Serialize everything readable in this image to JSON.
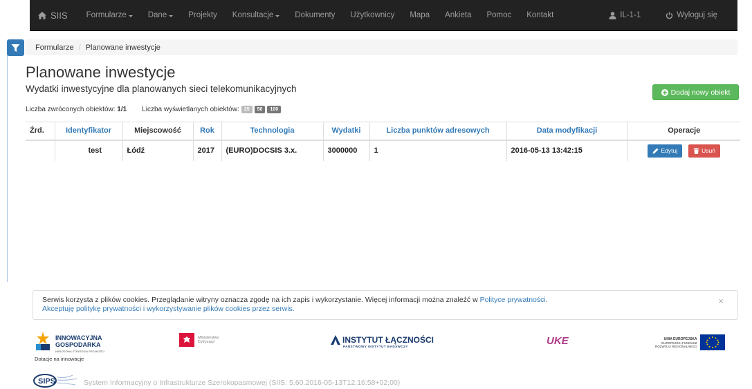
{
  "navbar": {
    "brand": "SIIS",
    "items": [
      {
        "label": "Formularze",
        "dropdown": true
      },
      {
        "label": "Dane",
        "dropdown": true
      },
      {
        "label": "Projekty",
        "dropdown": false
      },
      {
        "label": "Konsultacje",
        "dropdown": true
      },
      {
        "label": "Dokumenty",
        "dropdown": false
      },
      {
        "label": "Użytkownicy",
        "dropdown": false
      },
      {
        "label": "Mapa",
        "dropdown": false
      },
      {
        "label": "Ankieta",
        "dropdown": false
      },
      {
        "label": "Pomoc",
        "dropdown": false
      },
      {
        "label": "Kontakt",
        "dropdown": false
      }
    ],
    "user": "IL-1-1",
    "logout": "Wyloguj się"
  },
  "breadcrumb": {
    "parent": "Formularze",
    "current": "Planowane inwestycje"
  },
  "page": {
    "title": "Planowane inwestycje",
    "subtitle": "Wydatki inwestycyjne dla planowanych sieci telekomunikacyjnych",
    "add_button": "Dodaj nowy obiekt",
    "returned_label": "Liczba zwróconych obiektów:",
    "returned_value": "1/1",
    "displayed_label": "Liczba wyświetlanych obiektów:",
    "page_sizes": [
      "25",
      "50",
      "100"
    ]
  },
  "table": {
    "headers": [
      "Źrd.",
      "Identyfikator",
      "Miejscowość",
      "Rok",
      "Technologia",
      "Wydatki",
      "Liczba punktów adresowych",
      "Data modyfikacji",
      "Operacje"
    ],
    "rows": [
      {
        "zrd": "",
        "identyfikator": "test",
        "miejscowosc": "Łódź",
        "rok": "2017",
        "technologia": "(EURO)DOCSIS 3.x.",
        "wydatki": "3000000",
        "liczba_punktow": "1",
        "data": "2016-05-13 13:42:15"
      }
    ],
    "edit_label": "Edytuj",
    "delete_label": "Usuń"
  },
  "cookie": {
    "text": "Serwis korzysta z plików cookies. Przeglądanie witryny oznacza zgodę na ich zapis i wykorzystanie. Więcej informacji można znaleźć w",
    "policy_link": "Polityce prywatności.",
    "accept_link": "Akceptuję politykę prywatności i wykorzystywanie plików cookies przez serwis.",
    "close": "×"
  },
  "footer": {
    "ig_line1": "INNOWACYJNA",
    "ig_line2": "GOSPODARKA",
    "ig_line3": "NARODOWA STRATEGIA SPÓJNOŚCI",
    "ig_caption": "Dotacje na innowacje",
    "ministry_line1": "Ministerstwo",
    "ministry_line2": "Cyfryzacji",
    "il_main": "INSTYTUT ŁĄCZNOŚCI",
    "il_sub": "PAŃSTWOWY INSTYTUT BADAWCZY",
    "uke": "UKE",
    "ue_line1": "UNIA EUROPEJSKA",
    "ue_line2": "EUROPEJSKI FUNDUSZ",
    "ue_line3": "ROZWOJU REGIONALNEGO",
    "sips": "SIPS",
    "system_info": "System Informacyjny o Infrastrukturze Szerokopasmowej  (SIIS: 5.60.2016-05-13T12:16:58+02:00)"
  }
}
